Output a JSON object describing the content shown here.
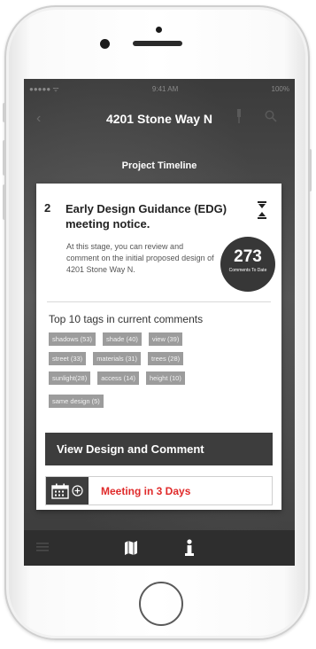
{
  "status_bar": {
    "carrier": "●●●●● ᯤ",
    "time": "9:41 AM",
    "battery": "100%"
  },
  "nav": {
    "title": "4201 Stone Way N"
  },
  "timeline": {
    "label": "Project Timeline"
  },
  "card": {
    "step_number": "2",
    "title": "Early Design Guidance (EDG) meeting notice.",
    "description": "At this stage, you can review and comment on the initial proposed design of 4201 Stone Way N.",
    "comment_count": "273",
    "comment_count_label": "Comments To Date",
    "tags_heading": "Top 10 tags in current comments",
    "tags": [
      "shadows (53)",
      "shade (40)",
      "view (39)",
      "street (33)",
      "materials (31)",
      "trees (28)",
      "sunlight(28)",
      "access (14)",
      "height (10)",
      "same design (5)"
    ],
    "cta_label": "View Design and Comment",
    "meeting_label": "Meeting in 3 Days"
  },
  "colors": {
    "accent_red": "#e02a2a",
    "dark": "#3d3d3d",
    "tag_gray": "#9c9c9c"
  },
  "icons": [
    "back-icon",
    "pin-icon",
    "search-icon",
    "collapse-icon",
    "calendar-icon",
    "add-circle-icon",
    "menu-icon",
    "map-icon",
    "info-icon"
  ]
}
